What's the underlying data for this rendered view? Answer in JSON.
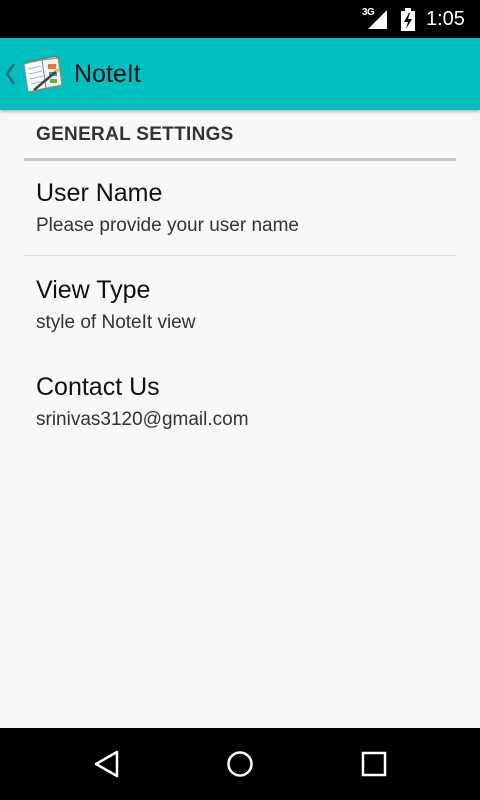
{
  "status_bar": {
    "network": "3G",
    "time": "1:05"
  },
  "action_bar": {
    "title": "NoteIt",
    "up_icon": "chevron-left-icon",
    "app_icon": "notebook-icon",
    "color": "#00bfbf"
  },
  "settings": {
    "category": "GENERAL SETTINGS",
    "items": [
      {
        "title": "User Name",
        "summary": "Please provide your user name"
      },
      {
        "title": "View Type",
        "summary": "style of NoteIt view"
      },
      {
        "title": "Contact Us",
        "summary": "srinivas3120@gmail.com"
      }
    ]
  },
  "nav_bar": {
    "back": "back-triangle-icon",
    "home": "home-circle-icon",
    "recents": "recents-square-icon"
  }
}
